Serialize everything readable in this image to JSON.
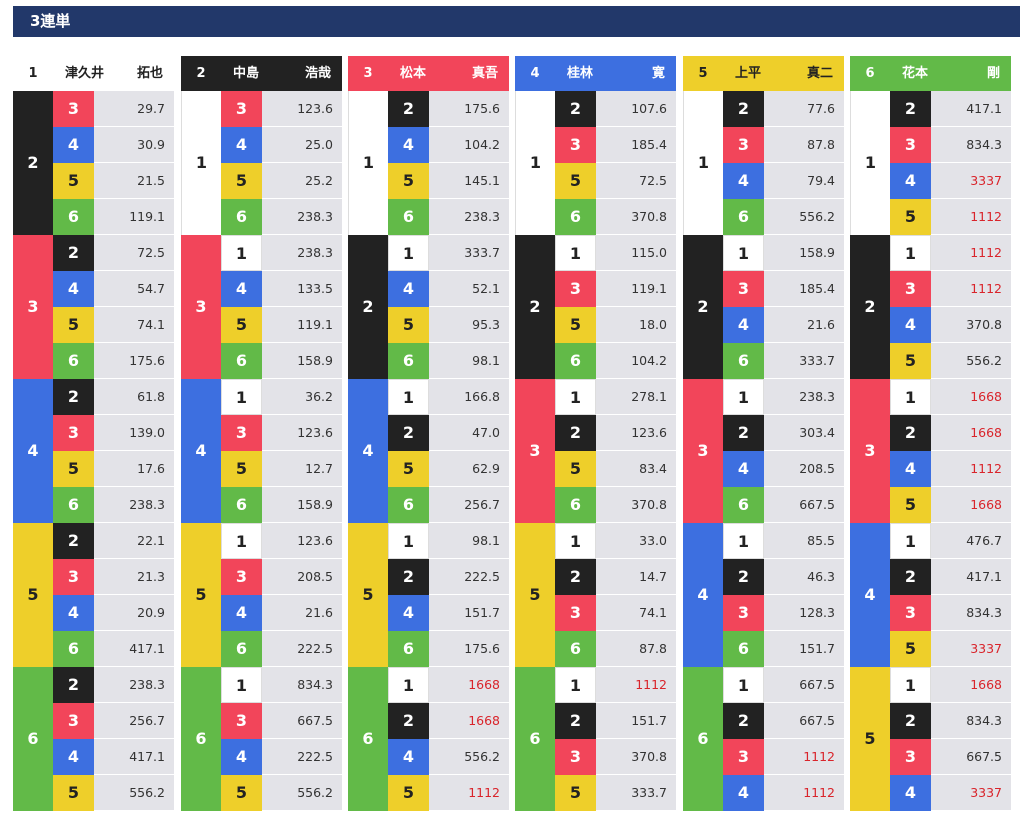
{
  "title": "3連単",
  "lane_colors": {
    "1": "#ffffff",
    "2": "#222222",
    "3": "#f2455a",
    "4": "#3d6fe0",
    "5": "#eecf2a",
    "6": "#62ba48"
  },
  "lane_text": {
    "1": "#222222",
    "2": "#ffffff",
    "3": "#ffffff",
    "4": "#ffffff",
    "5": "#222222",
    "6": "#ffffff"
  },
  "high_odds_color": "#d9242b",
  "columns": [
    {
      "first": "1",
      "surname": "津久井",
      "given": "拓也",
      "groups": [
        {
          "second": "2",
          "rows": [
            {
              "third": "3",
              "odds": "29.7"
            },
            {
              "third": "4",
              "odds": "30.9"
            },
            {
              "third": "5",
              "odds": "21.5"
            },
            {
              "third": "6",
              "odds": "119.1"
            }
          ]
        },
        {
          "second": "3",
          "rows": [
            {
              "third": "2",
              "odds": "72.5"
            },
            {
              "third": "4",
              "odds": "54.7"
            },
            {
              "third": "5",
              "odds": "74.1"
            },
            {
              "third": "6",
              "odds": "175.6"
            }
          ]
        },
        {
          "second": "4",
          "rows": [
            {
              "third": "2",
              "odds": "61.8"
            },
            {
              "third": "3",
              "odds": "139.0"
            },
            {
              "third": "5",
              "odds": "17.6"
            },
            {
              "third": "6",
              "odds": "238.3"
            }
          ]
        },
        {
          "second": "5",
          "rows": [
            {
              "third": "2",
              "odds": "22.1"
            },
            {
              "third": "3",
              "odds": "21.3"
            },
            {
              "third": "4",
              "odds": "20.9"
            },
            {
              "third": "6",
              "odds": "417.1"
            }
          ]
        },
        {
          "second": "6",
          "rows": [
            {
              "third": "2",
              "odds": "238.3"
            },
            {
              "third": "3",
              "odds": "256.7"
            },
            {
              "third": "4",
              "odds": "417.1"
            },
            {
              "third": "5",
              "odds": "556.2"
            }
          ]
        }
      ]
    },
    {
      "first": "2",
      "surname": "中島",
      "given": "浩哉",
      "groups": [
        {
          "second": "1",
          "rows": [
            {
              "third": "3",
              "odds": "123.6"
            },
            {
              "third": "4",
              "odds": "25.0"
            },
            {
              "third": "5",
              "odds": "25.2"
            },
            {
              "third": "6",
              "odds": "238.3"
            }
          ]
        },
        {
          "second": "3",
          "rows": [
            {
              "third": "1",
              "odds": "238.3"
            },
            {
              "third": "4",
              "odds": "133.5"
            },
            {
              "third": "5",
              "odds": "119.1"
            },
            {
              "third": "6",
              "odds": "158.9"
            }
          ]
        },
        {
          "second": "4",
          "rows": [
            {
              "third": "1",
              "odds": "36.2"
            },
            {
              "third": "3",
              "odds": "123.6"
            },
            {
              "third": "5",
              "odds": "12.7"
            },
            {
              "third": "6",
              "odds": "158.9"
            }
          ]
        },
        {
          "second": "5",
          "rows": [
            {
              "third": "1",
              "odds": "123.6"
            },
            {
              "third": "3",
              "odds": "208.5"
            },
            {
              "third": "4",
              "odds": "21.6"
            },
            {
              "third": "6",
              "odds": "222.5"
            }
          ]
        },
        {
          "second": "6",
          "rows": [
            {
              "third": "1",
              "odds": "834.3"
            },
            {
              "third": "3",
              "odds": "667.5"
            },
            {
              "third": "4",
              "odds": "222.5"
            },
            {
              "third": "5",
              "odds": "556.2"
            }
          ]
        }
      ]
    },
    {
      "first": "3",
      "surname": "松本",
      "given": "真吾",
      "groups": [
        {
          "second": "1",
          "rows": [
            {
              "third": "2",
              "odds": "175.6"
            },
            {
              "third": "4",
              "odds": "104.2"
            },
            {
              "third": "5",
              "odds": "145.1"
            },
            {
              "third": "6",
              "odds": "238.3"
            }
          ]
        },
        {
          "second": "2",
          "rows": [
            {
              "third": "1",
              "odds": "333.7"
            },
            {
              "third": "4",
              "odds": "52.1"
            },
            {
              "third": "5",
              "odds": "95.3"
            },
            {
              "third": "6",
              "odds": "98.1"
            }
          ]
        },
        {
          "second": "4",
          "rows": [
            {
              "third": "1",
              "odds": "166.8"
            },
            {
              "third": "2",
              "odds": "47.0"
            },
            {
              "third": "5",
              "odds": "62.9"
            },
            {
              "third": "6",
              "odds": "256.7"
            }
          ]
        },
        {
          "second": "5",
          "rows": [
            {
              "third": "1",
              "odds": "98.1"
            },
            {
              "third": "2",
              "odds": "222.5"
            },
            {
              "third": "4",
              "odds": "151.7"
            },
            {
              "third": "6",
              "odds": "175.6"
            }
          ]
        },
        {
          "second": "6",
          "rows": [
            {
              "third": "1",
              "odds": "1668",
              "high": true
            },
            {
              "third": "2",
              "odds": "1668",
              "high": true
            },
            {
              "third": "4",
              "odds": "556.2"
            },
            {
              "third": "5",
              "odds": "1112",
              "high": true
            }
          ]
        }
      ]
    },
    {
      "first": "4",
      "surname": "桂林",
      "given": "寛",
      "groups": [
        {
          "second": "1",
          "rows": [
            {
              "third": "2",
              "odds": "107.6"
            },
            {
              "third": "3",
              "odds": "185.4"
            },
            {
              "third": "5",
              "odds": "72.5"
            },
            {
              "third": "6",
              "odds": "370.8"
            }
          ]
        },
        {
          "second": "2",
          "rows": [
            {
              "third": "1",
              "odds": "115.0"
            },
            {
              "third": "3",
              "odds": "119.1"
            },
            {
              "third": "5",
              "odds": "18.0"
            },
            {
              "third": "6",
              "odds": "104.2"
            }
          ]
        },
        {
          "second": "3",
          "rows": [
            {
              "third": "1",
              "odds": "278.1"
            },
            {
              "third": "2",
              "odds": "123.6"
            },
            {
              "third": "5",
              "odds": "83.4"
            },
            {
              "third": "6",
              "odds": "370.8"
            }
          ]
        },
        {
          "second": "5",
          "rows": [
            {
              "third": "1",
              "odds": "33.0"
            },
            {
              "third": "2",
              "odds": "14.7"
            },
            {
              "third": "3",
              "odds": "74.1"
            },
            {
              "third": "6",
              "odds": "87.8"
            }
          ]
        },
        {
          "second": "6",
          "rows": [
            {
              "third": "1",
              "odds": "1112",
              "high": true
            },
            {
              "third": "2",
              "odds": "151.7"
            },
            {
              "third": "3",
              "odds": "370.8"
            },
            {
              "third": "5",
              "odds": "333.7"
            }
          ]
        }
      ]
    },
    {
      "first": "5",
      "surname": "上平",
      "given": "真二",
      "groups": [
        {
          "second": "1",
          "rows": [
            {
              "third": "2",
              "odds": "77.6"
            },
            {
              "third": "3",
              "odds": "87.8"
            },
            {
              "third": "4",
              "odds": "79.4"
            },
            {
              "third": "6",
              "odds": "556.2"
            }
          ]
        },
        {
          "second": "2",
          "rows": [
            {
              "third": "1",
              "odds": "158.9"
            },
            {
              "third": "3",
              "odds": "185.4"
            },
            {
              "third": "4",
              "odds": "21.6"
            },
            {
              "third": "6",
              "odds": "333.7"
            }
          ]
        },
        {
          "second": "3",
          "rows": [
            {
              "third": "1",
              "odds": "238.3"
            },
            {
              "third": "2",
              "odds": "303.4"
            },
            {
              "third": "4",
              "odds": "208.5"
            },
            {
              "third": "6",
              "odds": "667.5"
            }
          ]
        },
        {
          "second": "4",
          "rows": [
            {
              "third": "1",
              "odds": "85.5"
            },
            {
              "third": "2",
              "odds": "46.3"
            },
            {
              "third": "3",
              "odds": "128.3"
            },
            {
              "third": "6",
              "odds": "151.7"
            }
          ]
        },
        {
          "second": "6",
          "rows": [
            {
              "third": "1",
              "odds": "667.5"
            },
            {
              "third": "2",
              "odds": "667.5"
            },
            {
              "third": "3",
              "odds": "1112",
              "high": true
            },
            {
              "third": "4",
              "odds": "1112",
              "high": true
            }
          ]
        }
      ]
    },
    {
      "first": "6",
      "surname": "花本",
      "given": "剛",
      "groups": [
        {
          "second": "1",
          "rows": [
            {
              "third": "2",
              "odds": "417.1"
            },
            {
              "third": "3",
              "odds": "834.3"
            },
            {
              "third": "4",
              "odds": "3337",
              "high": true
            },
            {
              "third": "5",
              "odds": "1112",
              "high": true
            }
          ]
        },
        {
          "second": "2",
          "rows": [
            {
              "third": "1",
              "odds": "1112",
              "high": true
            },
            {
              "third": "3",
              "odds": "1112",
              "high": true
            },
            {
              "third": "4",
              "odds": "370.8"
            },
            {
              "third": "5",
              "odds": "556.2"
            }
          ]
        },
        {
          "second": "3",
          "rows": [
            {
              "third": "1",
              "odds": "1668",
              "high": true
            },
            {
              "third": "2",
              "odds": "1668",
              "high": true
            },
            {
              "third": "4",
              "odds": "1112",
              "high": true
            },
            {
              "third": "5",
              "odds": "1668",
              "high": true
            }
          ]
        },
        {
          "second": "4",
          "rows": [
            {
              "third": "1",
              "odds": "476.7"
            },
            {
              "third": "2",
              "odds": "417.1"
            },
            {
              "third": "3",
              "odds": "834.3"
            },
            {
              "third": "5",
              "odds": "3337",
              "high": true
            }
          ]
        },
        {
          "second": "5",
          "rows": [
            {
              "third": "1",
              "odds": "1668",
              "high": true
            },
            {
              "third": "2",
              "odds": "834.3"
            },
            {
              "third": "3",
              "odds": "667.5"
            },
            {
              "third": "4",
              "odds": "3337",
              "high": true
            }
          ]
        }
      ]
    }
  ]
}
